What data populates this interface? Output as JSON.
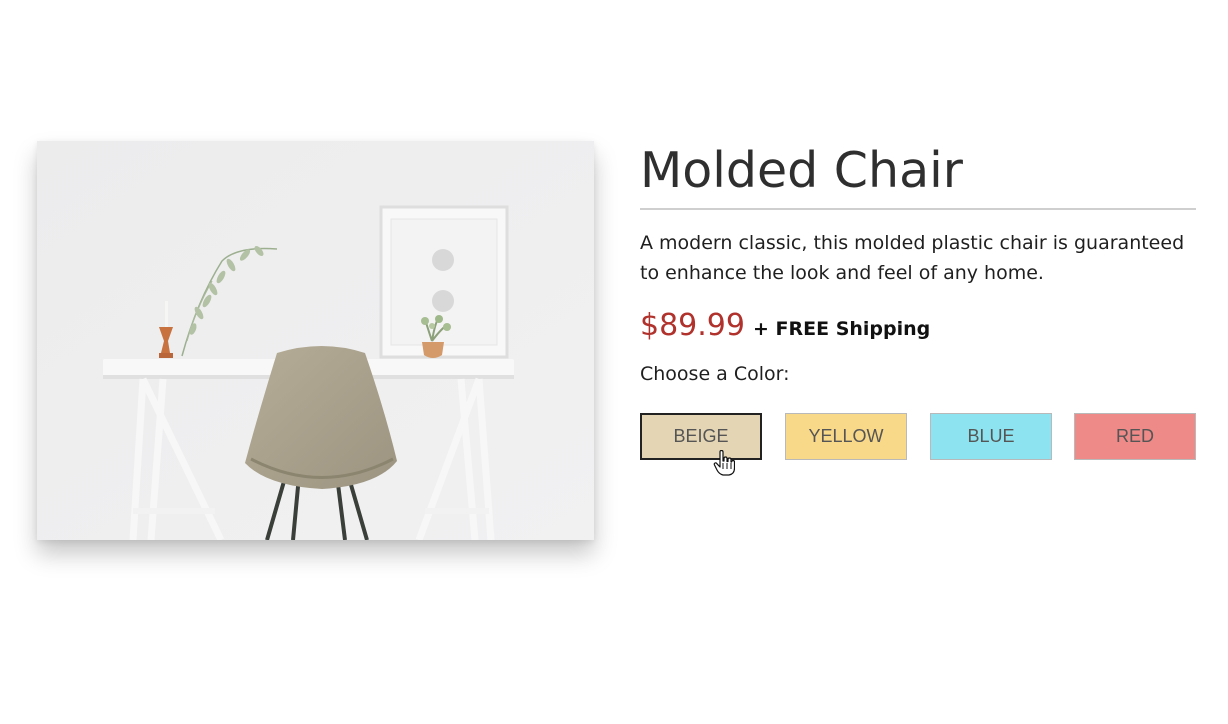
{
  "product": {
    "title": "Molded Chair",
    "description": "A modern classic, this molded plastic chair is guaranteed to enhance the look and feel of any home.",
    "price": "$89.99",
    "shipping": "+ FREE Shipping",
    "image_icon": "desk-and-chair-photo"
  },
  "color_picker": {
    "label": "Choose a Color:",
    "selected": "BEIGE",
    "options": [
      {
        "label": "BEIGE",
        "color": "#e4d6b4"
      },
      {
        "label": "YELLOW",
        "color": "#f8d889"
      },
      {
        "label": "BLUE",
        "color": "#8ee3f0"
      },
      {
        "label": "RED",
        "color": "#ee8a88"
      }
    ]
  },
  "cursor_icon": "hand-pointer-icon",
  "colors": {
    "price": "#b1322c",
    "title": "#2f2f2f"
  }
}
